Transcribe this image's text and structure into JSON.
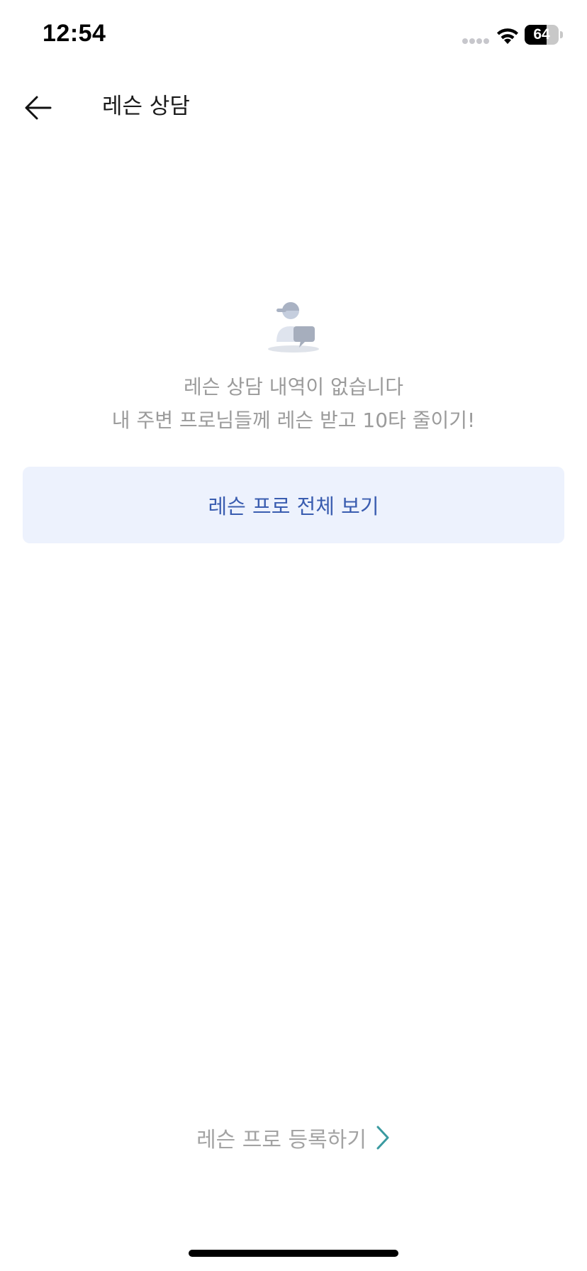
{
  "status_bar": {
    "time": "12:54",
    "battery_level": "64",
    "battery_fraction": 0.64,
    "icons": [
      "cellular-signal-icon",
      "wifi-icon",
      "battery-icon"
    ]
  },
  "header": {
    "title": "레슨 상담",
    "back_icon": "arrow-left-icon"
  },
  "empty_state": {
    "icon": "golfer-chat-icon",
    "message_line1": "레슨 상담 내역이 없습니다",
    "message_line2": "내 주변 프로님들께 레슨 받고 10타 줄이기!"
  },
  "actions": {
    "view_all_label": "레슨 프로 전체 보기",
    "register_label": "레슨 프로 등록하기",
    "register_icon": "chevron-right-icon"
  },
  "colors": {
    "button_bg": "#edf2fd",
    "button_text": "#3a5db0",
    "muted_text": "#9b9b9b",
    "chevron": "#3a9aa0"
  }
}
